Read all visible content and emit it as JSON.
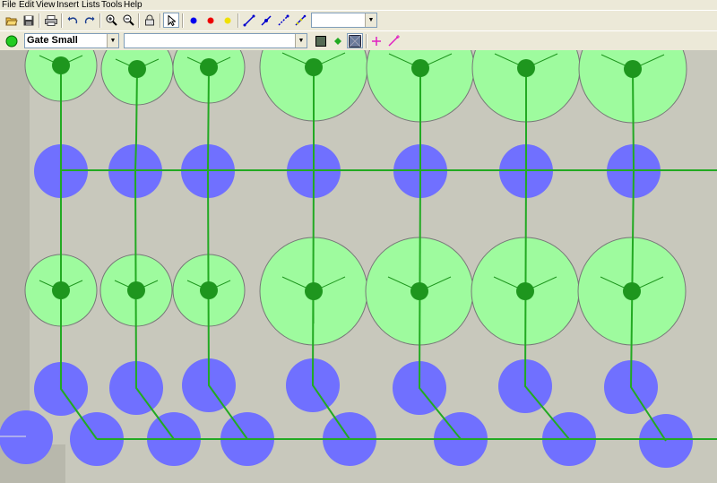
{
  "menu": {
    "items": [
      "File",
      "Edit",
      "View",
      "Insert",
      "Lists",
      "Tools",
      "Help"
    ]
  },
  "toolbar": {
    "icons": [
      "open-icon",
      "save-icon",
      "print-icon",
      "undo-icon",
      "redo-icon",
      "zoom-in-icon",
      "zoom-out-icon",
      "lock-icon",
      "select-arrow-icon",
      "blue-node-icon",
      "red-node-icon",
      "yellow-node-icon",
      "line-tool-icon",
      "line-node-tool-icon",
      "dashed-line-tool-icon",
      "multi-node-line-icon"
    ],
    "combo_value": ""
  },
  "layer_bar": {
    "status_color": "#22cc22",
    "layer_select": "Gate Small",
    "secondary_select": "",
    "tools": [
      "shape-fill-icon",
      "green-diamond-icon",
      "texture-icon",
      "pink-crosshair-icon",
      "pink-line-icon"
    ]
  },
  "canvas": {
    "background": "#c8c8bc",
    "node_fill_blue": "#7070ff",
    "gate_fill_green": "#9efb9e",
    "gate_center_green": "#1e961e",
    "wire_color": "#22aa22"
  }
}
